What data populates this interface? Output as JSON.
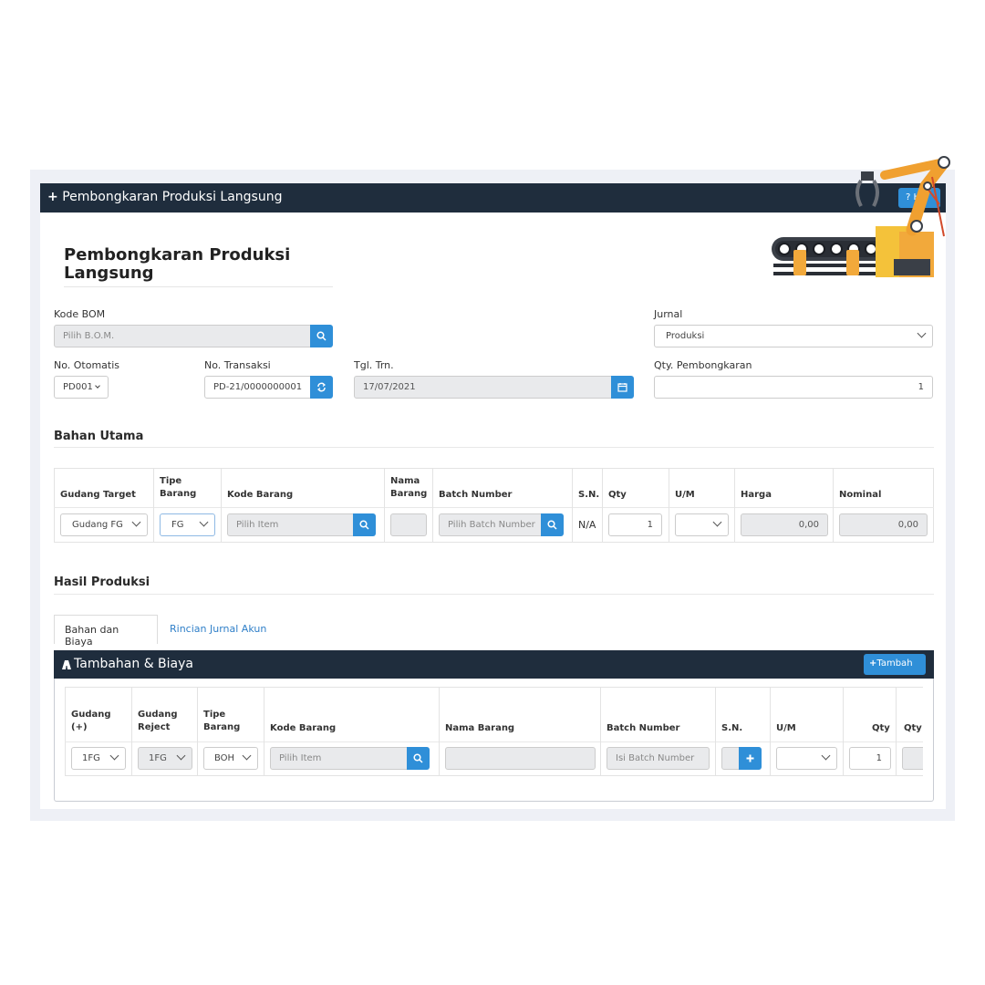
{
  "window": {
    "title": "Pembongkaran Produksi Langsung",
    "help_label": "? H"
  },
  "page": {
    "title": "Pembongkaran Produksi Langsung"
  },
  "form": {
    "kode_bom": {
      "label": "Kode BOM",
      "placeholder": "Pilih B.O.M."
    },
    "jurnal": {
      "label": "Jurnal",
      "value": "Produksi"
    },
    "no_otomatis": {
      "label": "No. Otomatis",
      "value": "PD001"
    },
    "no_transaksi": {
      "label": "No. Transaksi",
      "value": "PD-21/0000000001"
    },
    "tgl_trn": {
      "label": "Tgl. Trn.",
      "value": "17/07/2021"
    },
    "qty_pembongkaran": {
      "label": "Qty. Pembongkaran",
      "value": "1"
    }
  },
  "bahan_utama": {
    "title": "Bahan Utama",
    "columns": [
      "Gudang Target",
      "Tipe Barang",
      "Kode Barang",
      "Nama Barang",
      "Batch Number",
      "S.N.",
      "Qty",
      "U/M",
      "Harga",
      "Nominal"
    ],
    "row": {
      "gudang_target": "Gudang FG",
      "tipe_barang": "FG",
      "kode_barang_placeholder": "Pilih Item",
      "batch_placeholder": "Pilih Batch Number",
      "sn": "N/A",
      "qty": "1",
      "harga": "0,00",
      "nominal": "0,00"
    }
  },
  "hasil_produksi": {
    "title": "Hasil Produksi",
    "tabs": [
      "Bahan dan Biaya",
      "Rincian Jurnal Akun"
    ],
    "panel_title": "Tambahan & Biaya",
    "add_label": "Tambah",
    "columns": [
      "Gudang (+)",
      "Gudang Reject",
      "Tipe Barang",
      "Kode Barang",
      "Nama Barang",
      "Batch Number",
      "S.N.",
      "U/M",
      "Qty",
      "Qty"
    ],
    "row": {
      "gudang_plus": "1FG",
      "gudang_reject": "1FG",
      "tipe_barang": "BOH",
      "kode_barang_placeholder": "Pilih Item",
      "batch_placeholder": "Isi Batch Number",
      "qty": "1"
    }
  },
  "colors": {
    "header_dark": "#1f2d3d",
    "accent_blue": "#2f8fd8",
    "readonly_gray": "#e9eaec"
  },
  "icons": [
    "plus-icon",
    "search-icon",
    "refresh-icon",
    "calendar-icon",
    "chevron-down-icon",
    "robot-arm-illustration"
  ]
}
